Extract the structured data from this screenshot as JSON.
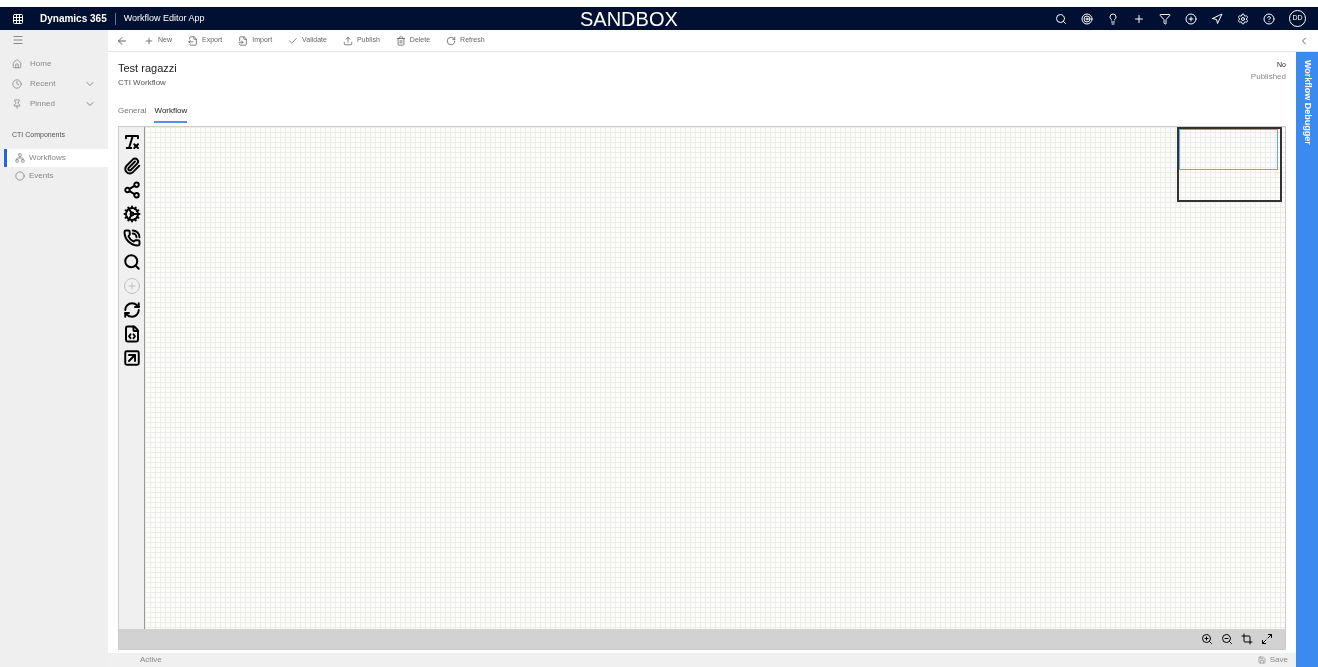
{
  "header": {
    "brand": "Dynamics 365",
    "app_name": "Workflow Editor App",
    "environment": "SANDBOX",
    "avatar": "DD"
  },
  "toolbar": [
    {
      "label": "New"
    },
    {
      "label": "Export"
    },
    {
      "label": "Import"
    },
    {
      "label": "Validate"
    },
    {
      "label": "Publish"
    },
    {
      "label": "Delete"
    },
    {
      "label": "Refresh"
    }
  ],
  "sidebar": {
    "items": [
      {
        "label": "Home",
        "expandable": false
      },
      {
        "label": "Recent",
        "expandable": true
      },
      {
        "label": "Pinned",
        "expandable": true
      }
    ],
    "group": "CTI Components",
    "group_items": [
      {
        "label": "Workflows",
        "selected": true
      },
      {
        "label": "Events",
        "selected": false
      }
    ]
  },
  "record": {
    "title": "Test ragazzi",
    "subtitle": "CTI Workflow",
    "status_value": "No",
    "status_label": "Published"
  },
  "tabs": [
    {
      "label": "General",
      "selected": false
    },
    {
      "label": "Workflow",
      "selected": true
    }
  ],
  "palette": [
    {
      "disabled": false
    },
    {
      "disabled": false
    },
    {
      "disabled": false
    },
    {
      "disabled": false
    },
    {
      "disabled": false
    },
    {
      "disabled": false
    },
    {
      "disabled": true
    },
    {
      "disabled": false
    },
    {
      "disabled": false
    },
    {
      "disabled": false
    }
  ],
  "debugger": {
    "label": "Workflow Debugger"
  },
  "status_bar": {
    "state": "Active",
    "save": "Save"
  }
}
